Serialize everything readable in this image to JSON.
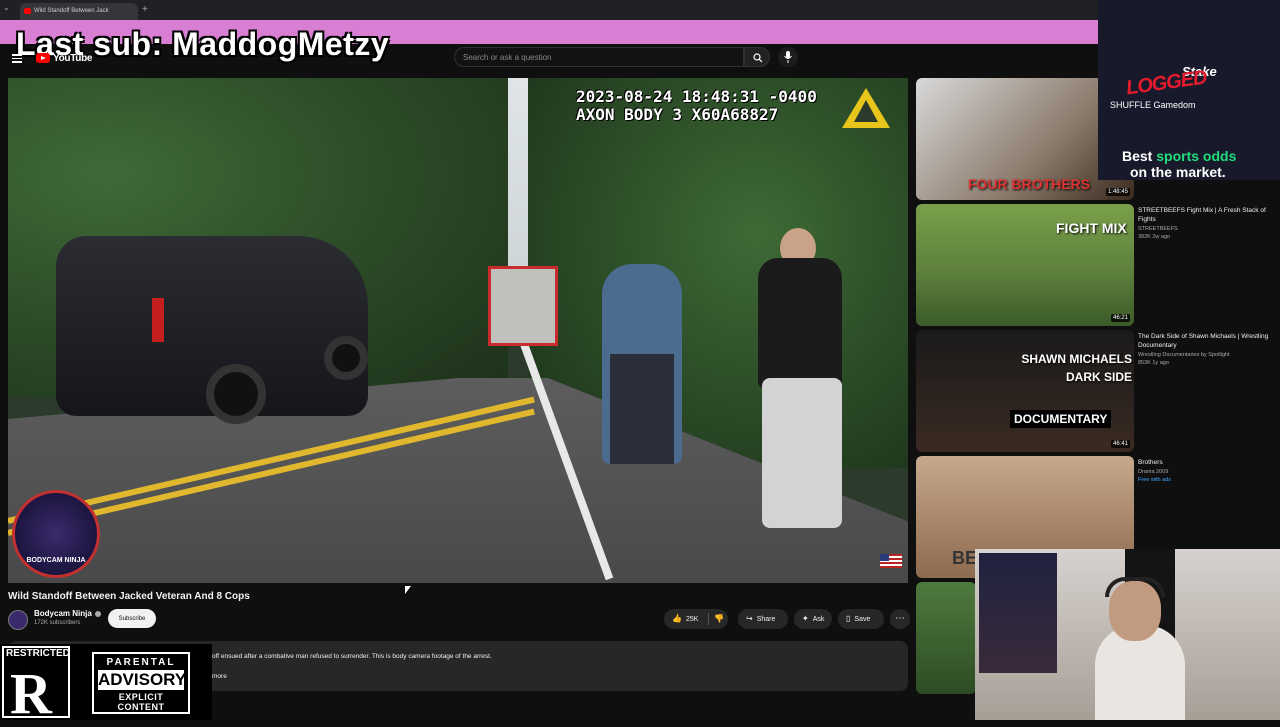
{
  "browser": {
    "tab_title": "Wild Standoff Between Jack"
  },
  "overlay": {
    "last_sub": "Last sub: MaddogMetzy"
  },
  "header": {
    "logo_text": "YouTube",
    "search_placeholder": "Search or ask a question"
  },
  "player": {
    "timestamp_line1": "2023-08-24 18:48:31 -0400",
    "timestamp_line2": "AXON BODY 3 X60A68827",
    "badge_text": "BODYCAM NINJA"
  },
  "video": {
    "title": "Wild Standoff Between Jacked Veteran And 8 Cops",
    "channel_name": "Bodycam Ninja",
    "subscribers": "172K subscribers",
    "subscribe_label": "Subscribe",
    "likes": "25K",
    "share_label": "Share",
    "ask_label": "Ask",
    "save_label": "Save",
    "description": "off ensued after a combative man refused to surrender.  This is body camera footage of the arrest.",
    "more_label": "more"
  },
  "recommendations": [
    {
      "thumb_text": "FOUR BROTHERS",
      "duration": "1:48:45",
      "title": "",
      "channel": "",
      "stats": ""
    },
    {
      "thumb_text": "FIGHT MIX",
      "duration": "46:21",
      "title": "STREETBEEFS Fight Mix | A Fresh Stack of Fights",
      "channel": "STREETBEEFS",
      "stats": "382K  2w ago"
    },
    {
      "thumb_text": "SHAWN MICHAELS DARK SIDE",
      "thumb_sub": "DOCUMENTARY",
      "duration": "46:41",
      "title": "The Dark Side of Shawn Michaels | Wrestling Documentary",
      "channel": "Wrestling Documentaries by Spotlight",
      "stats": "853K  1y ago"
    },
    {
      "thumb_text": "BE",
      "duration": "",
      "title": "Brothers",
      "channel": "Drama 2009",
      "stats": "",
      "badge": "Free with ads"
    }
  ],
  "ad": {
    "brand": "Stake",
    "stamp": "LOGGED",
    "partners": "SHUFFLE   Gamedom",
    "line1_highlight": "sports odds",
    "line1_prefix": "Best",
    "line2": "on the market."
  },
  "rating": {
    "restricted_label": "RESTRICTED",
    "restricted_letter": "R",
    "advisory_line1": "PARENTAL",
    "advisory_line2": "ADVISORY",
    "advisory_line3": "EXPLICIT CONTENT"
  },
  "colors": {
    "banner": "#d87ed3",
    "youtube_red": "#ff0000",
    "page_bg": "#0f0f0f",
    "ad_green": "#1fdd7b"
  }
}
